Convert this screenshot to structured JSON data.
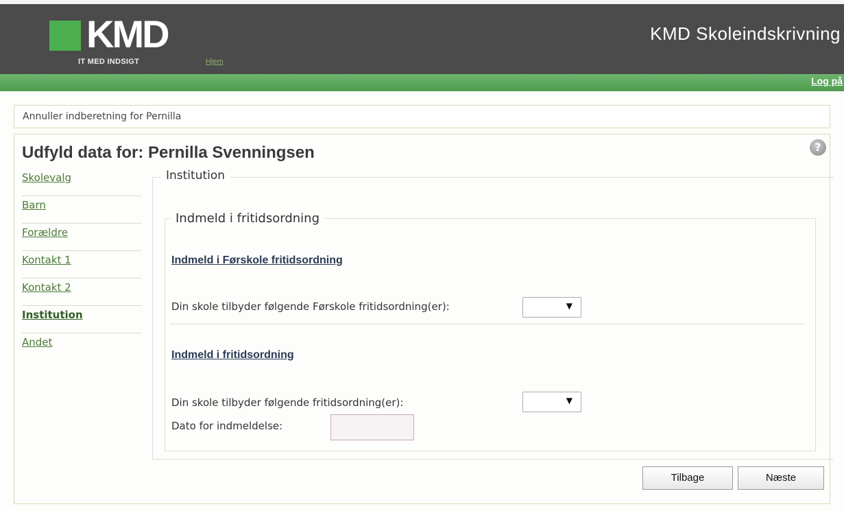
{
  "header": {
    "logo_text": "KMD",
    "logo_tagline": "IT MED INDSIGT",
    "home_link": "Hjem",
    "app_title": "KMD Skoleindskrivning",
    "logout_link": "Log på"
  },
  "cancel_link": "Annuller indberetning for Pernilla",
  "page_title": "Udfyld data for: Pernilla Svenningsen",
  "sidenav": {
    "items": [
      {
        "label": "Skolevalg"
      },
      {
        "label": "Barn"
      },
      {
        "label": "Forældre"
      },
      {
        "label": "Kontakt 1"
      },
      {
        "label": "Kontakt 2"
      },
      {
        "label": "Institution",
        "active": true
      },
      {
        "label": "Andet"
      }
    ]
  },
  "main": {
    "section_legend": "Institution",
    "subsection_legend": "Indmeld i fritidsordning",
    "preschool": {
      "heading": "Indmeld i Førskole fritidsordning",
      "label": "Din skole tilbyder følgende Førskole fritidsordning(er):",
      "selected": ""
    },
    "afterschool": {
      "heading": "Indmeld i fritidsordning",
      "label": "Din skole tilbyder følgende fritidsordning(er):",
      "selected": "",
      "date_label": "Dato for indmeldelse:",
      "date_value": ""
    }
  },
  "buttons": {
    "back": "Tilbage",
    "next": "Næste"
  },
  "icons": {
    "help": "help-icon",
    "dropdown_arrow": "chevron-down-icon"
  },
  "colors": {
    "header_bg": "#4a4b4a",
    "accent_green": "#4caf50",
    "nav_link": "#4a7a36"
  }
}
